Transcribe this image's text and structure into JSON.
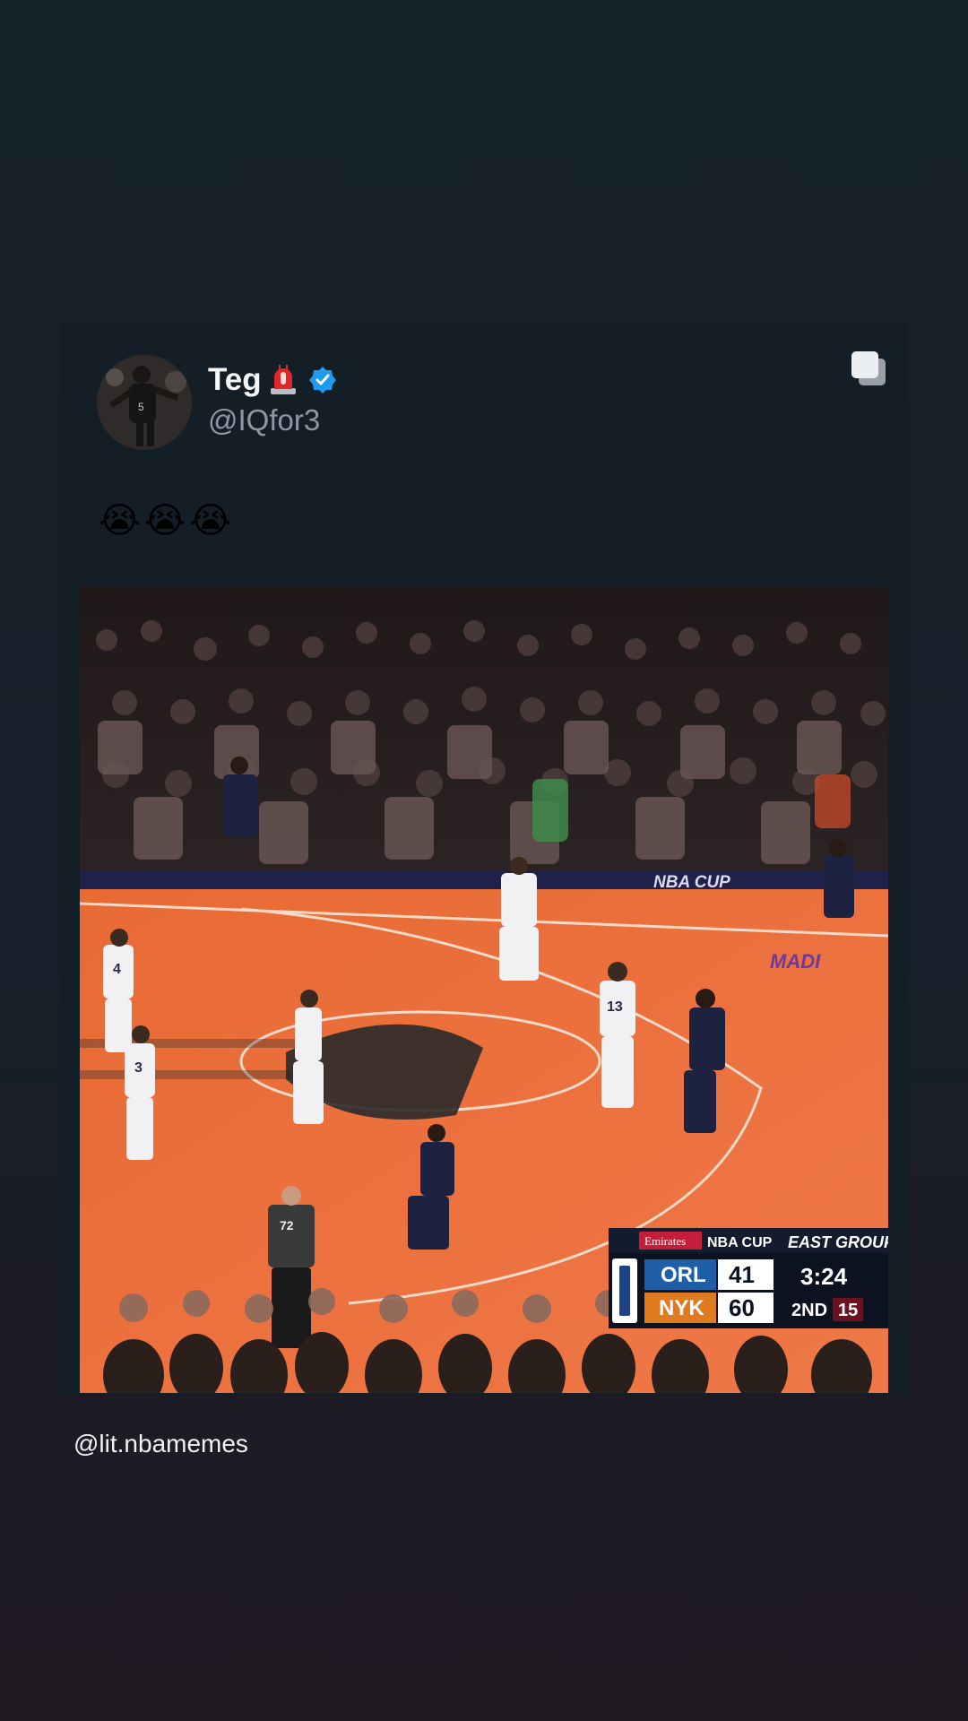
{
  "tweet": {
    "display_name": "Teg",
    "name_emoji_icon": "police-light-icon",
    "verified_icon": "verified-badge-icon",
    "handle": "@IQfor3",
    "text": "😭😭😭",
    "action_icon": "copy-icon"
  },
  "media": {
    "court_banner": "NBA CUP",
    "arena_text": "MADI",
    "referee_number": "72",
    "jersey_numbers": [
      "4",
      "3",
      "13"
    ],
    "scoreboard": {
      "sponsor": "Emirates",
      "event": "NBA CUP",
      "group": "EAST GROUP",
      "team1": "ORL",
      "score1": "41",
      "team2": "NYK",
      "score2": "60",
      "clock": "3:24",
      "period": "2ND",
      "shot_clock": "15",
      "colors": {
        "orl": "#1f5fa8",
        "nyk": "#e07a1f",
        "dark": "#0d1220"
      }
    }
  },
  "watermark": "@lit.nbamemes",
  "colors": {
    "background": "#152128",
    "card": "#141e26",
    "verified": "#1d9bf0",
    "court": "#e8652e"
  }
}
